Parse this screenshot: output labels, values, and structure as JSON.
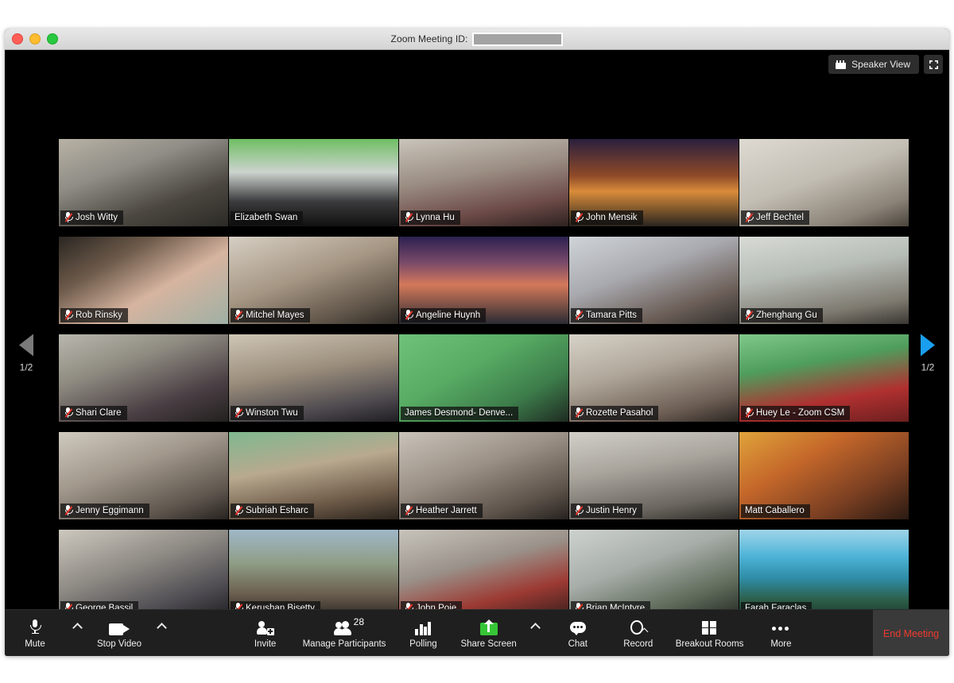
{
  "window": {
    "title_label": "Zoom Meeting ID:",
    "meeting_id_redacted": "",
    "traffic_lights": [
      "close",
      "minimize",
      "zoom"
    ]
  },
  "topbar": {
    "view_button": "Speaker View",
    "view_icon": "grid-view-icon",
    "fullscreen_icon": "enter-fullscreen-icon"
  },
  "pager": {
    "prev_icon": "chevron-left-icon",
    "next_icon": "chevron-right-icon",
    "left_label": "1/2",
    "right_label": "1/2",
    "prev_color": "#7a7a7a",
    "next_color": "#1a9ff0"
  },
  "gallery": {
    "columns": 5,
    "rows": 5,
    "active_speaker_color": "#d7e03a",
    "participants": [
      {
        "name": "Josh Witty",
        "muted": true,
        "active": false,
        "bg": "linear-gradient(160deg,#b9b2a5 0%,#8f8d86 35%,#4b4740 70%,#2b2a26 100%)"
      },
      {
        "name": "Elizabeth Swan",
        "muted": false,
        "active": false,
        "bg": "linear-gradient(180deg,#6fbe63 0%,#cdd3cf 38%,#3a3a3c 72%,#111111 100%)"
      },
      {
        "name": "Lynna Hu",
        "muted": true,
        "active": false,
        "bg": "linear-gradient(170deg,#c9c4bb 0%,#9c8f84 40%,#6d4b48 75%,#2d2220 100%)"
      },
      {
        "name": "John Mensik",
        "muted": true,
        "active": false,
        "bg": "linear-gradient(180deg,#2a1f3d 0%,#8f4a28 42%,#d98c3a 60%,#2a2520 100%)"
      },
      {
        "name": "Jeff Bechtel",
        "muted": true,
        "active": false,
        "bg": "linear-gradient(160deg,#dedad2 0%,#c3beb4 45%,#8b8378 80%,#4a443c 100%)"
      },
      {
        "name": "Rob Rinsky",
        "muted": true,
        "active": false,
        "bg": "linear-gradient(150deg,#2a2622 0%,#6d5a4a 30%,#d6b4a0 60%,#9fb0a4 100%)"
      },
      {
        "name": "Mitchel Mayes",
        "muted": true,
        "active": false,
        "bg": "linear-gradient(160deg,#d6cfc3 0%,#a69684 45%,#5f5448 80%,#2e2a25 100%)"
      },
      {
        "name": "Angeline Huynh",
        "muted": true,
        "active": false,
        "bg": "linear-gradient(180deg,#2c2150 0%,#7a4a6a 30%,#d4795a 55%,#2a2b33 100%)"
      },
      {
        "name": "Tamara Pitts",
        "muted": true,
        "active": false,
        "bg": "linear-gradient(160deg,#cfd4d8 0%,#a9aab0 40%,#6c5f58 75%,#32302e 100%)"
      },
      {
        "name": "Zhenghang Gu",
        "muted": true,
        "active": false,
        "bg": "linear-gradient(170deg,#d8dbd6 0%,#b6bcb6 40%,#7e7a70 78%,#3a3732 100%)"
      },
      {
        "name": "Shari Clare",
        "muted": true,
        "active": false,
        "bg": "linear-gradient(160deg,#b9b8ae 0%,#8e8a80 35%,#4a3f44 72%,#23201f 100%)"
      },
      {
        "name": "Winston Twu",
        "muted": true,
        "active": false,
        "bg": "linear-gradient(170deg,#cfc6b6 0%,#9b8e7c 42%,#4e4a4f 78%,#1f1e22 100%)"
      },
      {
        "name": "James Desmond- Denve...",
        "muted": false,
        "active": false,
        "bg": "linear-gradient(150deg,#6fc27a 0%,#57ab63 40%,#3d7d4b 72%,#1f2b22 100%)"
      },
      {
        "name": "Rozette Pasahol",
        "muted": true,
        "active": false,
        "bg": "linear-gradient(165deg,#d6d2c8 0%,#b0a79a 40%,#6e5f55 78%,#2c2723 100%)"
      },
      {
        "name": "Huey Le - Zoom CSM",
        "muted": true,
        "active": false,
        "bg": "linear-gradient(170deg,#7fc98a 0%,#4f9d5c 35%,#b03030 70%,#6d1f1f 100%)"
      },
      {
        "name": "Jenny Eggimann",
        "muted": true,
        "active": false,
        "bg": "linear-gradient(160deg,#cfcabf 0%,#a2988c 40%,#5f564e 78%,#272320 100%)"
      },
      {
        "name": "Subriah Esharc",
        "muted": true,
        "active": false,
        "bg": "linear-gradient(170deg,#7fb88f 0%,#b8a98f 40%,#6d5a48 75%,#2b241d 100%)"
      },
      {
        "name": "Heather Jarrett",
        "muted": true,
        "active": false,
        "bg": "linear-gradient(160deg,#c9c3ba 0%,#9b9086 42%,#5c5249 78%,#262220 100%)"
      },
      {
        "name": "Justin Henry",
        "muted": true,
        "active": false,
        "bg": "linear-gradient(170deg,#d2cfc8 0%,#a8a49c 40%,#6a655e 78%,#2e2b28 100%)"
      },
      {
        "name": "Matt Caballero",
        "muted": false,
        "active": false,
        "bg": "linear-gradient(150deg,#e0a33a 0%,#c4672a 35%,#7a3f22 70%,#2a1a12 100%)"
      },
      {
        "name": "George Bassil",
        "muted": true,
        "active": false,
        "bg": "linear-gradient(160deg,#cdc8be 0%,#8e8a84 42%,#4c4a50 78%,#201f22 100%)"
      },
      {
        "name": "Kerushan Bisetty",
        "muted": true,
        "active": false,
        "bg": "linear-gradient(180deg,#9fb7c8 0%,#8f9e86 38%,#6d6152 72%,#2e2823 100%)"
      },
      {
        "name": "John Poje",
        "muted": true,
        "active": false,
        "bg": "linear-gradient(165deg,#c8c4bb 0%,#9a928a 40%,#9c3a33 72%,#3a1f1d 100%)"
      },
      {
        "name": "Brian McIntyre",
        "muted": true,
        "active": false,
        "bg": "linear-gradient(160deg,#cdd2cf 0%,#a7ada8 40%,#5f6b5a 75%,#272b26 100%)"
      },
      {
        "name": "Farah Faraclas",
        "muted": false,
        "active": true,
        "bg": "linear-gradient(180deg,#9fd4e8 0%,#4fb4d8 30%,#2f8ea8 55%,#2d5f4a 80%,#1c3a2c 100%)"
      }
    ]
  },
  "toolbar": {
    "items": [
      {
        "label": "Mute",
        "icon": "microphone-icon",
        "caret": true,
        "badge": ""
      },
      {
        "label": "Stop Video",
        "icon": "video-camera-icon",
        "caret": true,
        "badge": ""
      },
      {
        "label": "Invite",
        "icon": "invite-person-icon",
        "caret": false,
        "badge": ""
      },
      {
        "label": "Manage Participants",
        "icon": "participants-icon",
        "caret": false,
        "badge": "28"
      },
      {
        "label": "Polling",
        "icon": "bar-chart-icon",
        "caret": false,
        "badge": ""
      },
      {
        "label": "Share Screen",
        "icon": "share-screen-icon",
        "caret": true,
        "badge": ""
      },
      {
        "label": "Chat",
        "icon": "chat-bubble-icon",
        "caret": false,
        "badge": ""
      },
      {
        "label": "Record",
        "icon": "record-icon",
        "caret": false,
        "badge": ""
      },
      {
        "label": "Breakout Rooms",
        "icon": "breakout-rooms-icon",
        "caret": false,
        "badge": ""
      },
      {
        "label": "More",
        "icon": "more-dots-icon",
        "caret": false,
        "badge": ""
      }
    ],
    "end_meeting_label": "End Meeting",
    "end_meeting_color": "#ee3b2f",
    "share_screen_accent": "#36c636"
  }
}
